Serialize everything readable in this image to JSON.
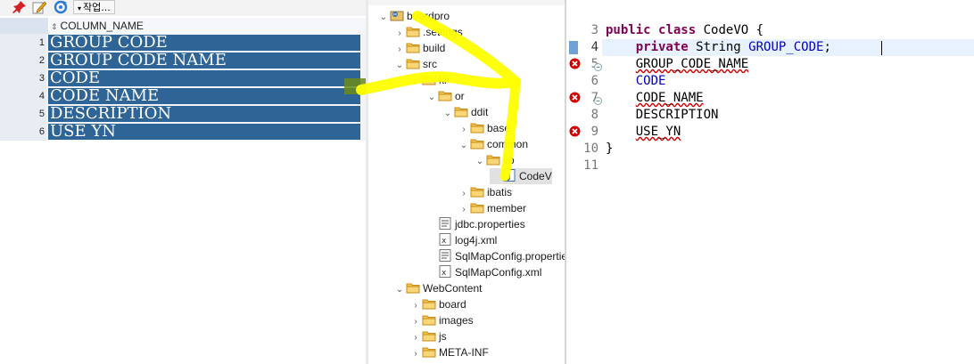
{
  "result_grid": {
    "toolbar": {
      "pin_icon": "pin-icon",
      "edit_icon": "pencil-icon",
      "refresh_icon": "refresh-icon",
      "actions_label": "작업...",
      "actions_arrow": "▾"
    },
    "header": {
      "sort_glyph": "⇕",
      "column_name": "COLUMN_NAME"
    },
    "rows": [
      {
        "num": "1",
        "value": "GROUP CODE"
      },
      {
        "num": "2",
        "value": "GROUP CODE NAME"
      },
      {
        "num": "3",
        "value": "CODE"
      },
      {
        "num": "4",
        "value": "CODE NAME"
      },
      {
        "num": "5",
        "value": "DESCRIPTION"
      },
      {
        "num": "6",
        "value": "USE YN"
      }
    ]
  },
  "package_explorer": {
    "nodes": [
      {
        "label": "boardpro",
        "expanded": "true",
        "icon": "project-icon"
      },
      {
        "label": ".settings",
        "expanded": "false",
        "icon": "folder-icon"
      },
      {
        "label": "build",
        "expanded": "false",
        "icon": "folder-icon"
      },
      {
        "label": "src",
        "expanded": "true",
        "icon": "folder-icon"
      },
      {
        "label": "kr",
        "expanded": "true",
        "icon": "folder-icon"
      },
      {
        "label": "or",
        "expanded": "true",
        "icon": "folder-icon"
      },
      {
        "label": "ddit",
        "expanded": "true",
        "icon": "folder-icon"
      },
      {
        "label": "base",
        "expanded": "false",
        "icon": "folder-icon"
      },
      {
        "label": "common",
        "expanded": "true",
        "icon": "folder-icon"
      },
      {
        "label": "vo",
        "expanded": "true",
        "icon": "folder-icon"
      },
      {
        "label": "CodeV",
        "expanded": "",
        "icon": "java-file-icon"
      },
      {
        "label": "ibatis",
        "expanded": "false",
        "icon": "folder-icon"
      },
      {
        "label": "member",
        "expanded": "false",
        "icon": "folder-icon"
      },
      {
        "label": "jdbc.properties",
        "expanded": "",
        "icon": "properties-file-icon"
      },
      {
        "label": "log4j.xml",
        "expanded": "",
        "icon": "xml-file-icon"
      },
      {
        "label": "SqlMapConfig.properties",
        "expanded": "",
        "icon": "properties-file-icon"
      },
      {
        "label": "SqlMapConfig.xml",
        "expanded": "",
        "icon": "xml-file-icon"
      },
      {
        "label": "WebContent",
        "expanded": "true",
        "icon": "folder-icon"
      },
      {
        "label": "board",
        "expanded": "false",
        "icon": "folder-icon"
      },
      {
        "label": "images",
        "expanded": "false",
        "icon": "folder-icon"
      },
      {
        "label": "js",
        "expanded": "false",
        "icon": "folder-icon"
      },
      {
        "label": "META-INF",
        "expanded": "false",
        "icon": "folder-icon"
      }
    ]
  },
  "editor": {
    "line_numbers": [
      "3",
      "4",
      "5",
      "6",
      "7",
      "8",
      "9",
      "10",
      "11"
    ],
    "code": {
      "line3_kw1": "public",
      "line3_kw2": "class",
      "line3_rest": " CodeVO {",
      "line4_kw": "private",
      "line4_type": " String ",
      "line4_field": "GROUP_CODE",
      "line4_end": ";",
      "line5": "GROUP_CODE_NAME",
      "line6": "CODE",
      "line7": "CODE_NAME",
      "line8": "DESCRIPTION",
      "line9": "USE_YN",
      "line10": "}"
    },
    "markers": {
      "line4": "bookmark-marker",
      "line5": "error-marker",
      "line7": "error-marker",
      "line9": "error-marker"
    },
    "colors": {
      "keyword": "#7f0055",
      "field": "#0000c0",
      "error": "#d40000",
      "current_line": "#e8f2fe",
      "selection": "#2f6496",
      "annotation": "#ffff00"
    }
  }
}
